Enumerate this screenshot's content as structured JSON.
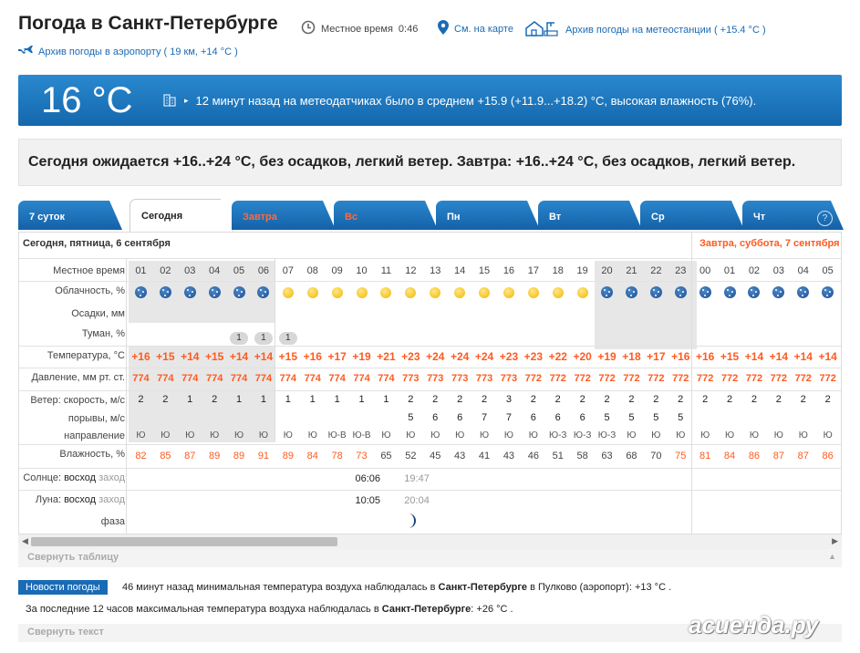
{
  "header": {
    "title": "Погода в Санкт-Петербурге",
    "local_time_label": "Местное время",
    "local_time": "0:46",
    "map_link": "См. на карте",
    "station_link": "Архив погоды на метеостанции ( +15.4 °C )",
    "airport_link": "Архив погоды в аэропорту ( 19 км, +14 °C )"
  },
  "current": {
    "temp": "16 °C",
    "description": "12 минут назад на метеодатчиках было в среднем +15.9 (+11.9...+18.2) °C, высокая влажность (76%)."
  },
  "forecast_text": "Сегодня ожидается +16..+24 °C, без осадков, легкий ветер. Завтра: +16..+24 °C, без осадков, легкий ветер.",
  "tabs": [
    {
      "label": "7 суток"
    },
    {
      "label": "Сегодня"
    },
    {
      "label": "Завтра"
    },
    {
      "label": "Вс"
    },
    {
      "label": "Пн"
    },
    {
      "label": "Вт"
    },
    {
      "label": "Ср"
    },
    {
      "label": "Чт"
    }
  ],
  "help_label": "?",
  "table": {
    "day_today": "Сегодня, пятница, 6 сентября",
    "day_tomorrow": "Завтра, суббота, 7 сентября",
    "row_labels": {
      "time": "Местное время",
      "cloud": "Облачность, %",
      "precip": "Осадки, мм",
      "fog": "Туман, %",
      "temp": "Температура, °C",
      "pressure": "Давление, мм рт. ст.",
      "wind": "Ветер: скорость, м/с",
      "gusts": "порывы, м/с",
      "direction": "направление",
      "humidity": "Влажность, %",
      "sun_prefix": "Солнце:",
      "sun_rise": "восход",
      "sun_set": "заход",
      "moon_prefix": "Луна:",
      "moon_rise": "восход",
      "moon_set": "заход",
      "phase": "фаза"
    },
    "hours": [
      "01",
      "02",
      "03",
      "04",
      "05",
      "06",
      "07",
      "08",
      "09",
      "10",
      "11",
      "12",
      "13",
      "14",
      "15",
      "16",
      "17",
      "18",
      "19",
      "20",
      "21",
      "22",
      "23",
      "00",
      "01",
      "02",
      "03",
      "04",
      "05"
    ],
    "cloud_icons": [
      "moon",
      "moon",
      "moon",
      "moon",
      "moon",
      "moon",
      "sun",
      "sun",
      "sun",
      "sun",
      "sun",
      "sun",
      "sun",
      "sun",
      "sun",
      "sun",
      "sun",
      "sun",
      "sun",
      "moon",
      "moon",
      "moon",
      "moon",
      "moon",
      "moon",
      "moon",
      "moon",
      "moon",
      "moon"
    ],
    "fog": [
      "",
      "",
      "",
      "",
      "1",
      "1",
      "1",
      "",
      "",
      "",
      "",
      "",
      "",
      "",
      "",
      "",
      "",
      "",
      "",
      "",
      "",
      "",
      "",
      "",
      "",
      "",
      "",
      "",
      ""
    ],
    "temp": [
      "+16",
      "+15",
      "+14",
      "+15",
      "+14",
      "+14",
      "+15",
      "+16",
      "+17",
      "+19",
      "+21",
      "+23",
      "+24",
      "+24",
      "+24",
      "+23",
      "+23",
      "+22",
      "+20",
      "+19",
      "+18",
      "+17",
      "+16",
      "+16",
      "+15",
      "+14",
      "+14",
      "+14",
      "+14"
    ],
    "pressure": [
      "774",
      "774",
      "774",
      "774",
      "774",
      "774",
      "774",
      "774",
      "774",
      "774",
      "774",
      "773",
      "773",
      "773",
      "773",
      "773",
      "772",
      "772",
      "772",
      "772",
      "772",
      "772",
      "772",
      "772",
      "772",
      "772",
      "772",
      "772",
      "772"
    ],
    "wind": [
      "2",
      "2",
      "1",
      "2",
      "1",
      "1",
      "1",
      "1",
      "1",
      "1",
      "1",
      "2",
      "2",
      "2",
      "2",
      "3",
      "2",
      "2",
      "2",
      "2",
      "2",
      "2",
      "2",
      "2",
      "2",
      "2",
      "2",
      "2",
      "2"
    ],
    "gusts": [
      "",
      "",
      "",
      "",
      "",
      "",
      "",
      "",
      "",
      "",
      "",
      "5",
      "6",
      "6",
      "7",
      "7",
      "6",
      "6",
      "6",
      "5",
      "5",
      "5",
      "5",
      "",
      "",
      "",
      "",
      "",
      ""
    ],
    "direction": [
      "Ю",
      "Ю",
      "Ю",
      "Ю",
      "Ю",
      "Ю",
      "Ю",
      "Ю",
      "Ю-В",
      "Ю-В",
      "Ю",
      "Ю",
      "Ю",
      "Ю",
      "Ю",
      "Ю",
      "Ю",
      "Ю-З",
      "Ю-З",
      "Ю-З",
      "Ю",
      "Ю",
      "Ю",
      "Ю",
      "Ю",
      "Ю",
      "Ю",
      "Ю",
      "Ю"
    ],
    "humidity": [
      "82",
      "85",
      "87",
      "89",
      "89",
      "91",
      "89",
      "84",
      "78",
      "73",
      "65",
      "52",
      "45",
      "43",
      "41",
      "43",
      "46",
      "51",
      "58",
      "63",
      "68",
      "70",
      "75",
      "81",
      "84",
      "86",
      "87",
      "87",
      "86"
    ],
    "sun_rise": "06:06",
    "sun_set": "19:47",
    "moon_rise": "10:05",
    "moon_set": "20:04"
  },
  "collapse_table": "Свернуть таблицу",
  "news": {
    "badge": "Новости погоды",
    "line1_a": "46 минут назад минимальная температура воздуха наблюдалась в",
    "line1_city": "Санкт-Петербурге",
    "line1_b": "в Пулково (аэропорт): +13 °C .",
    "line2_a": "За последние 12 часов максимальная температура воздуха наблюдалась в",
    "line2_city": "Санкт-Петербурге",
    "line2_b": ": +26 °C .",
    "collapse": "Свернуть текст"
  },
  "watermark": "асиенда.ру",
  "colors": {
    "accent": "#1a6bb5",
    "warm": "#ff5a1f",
    "tab_red": "#ff6a3c",
    "night": "#e7e7e7"
  }
}
